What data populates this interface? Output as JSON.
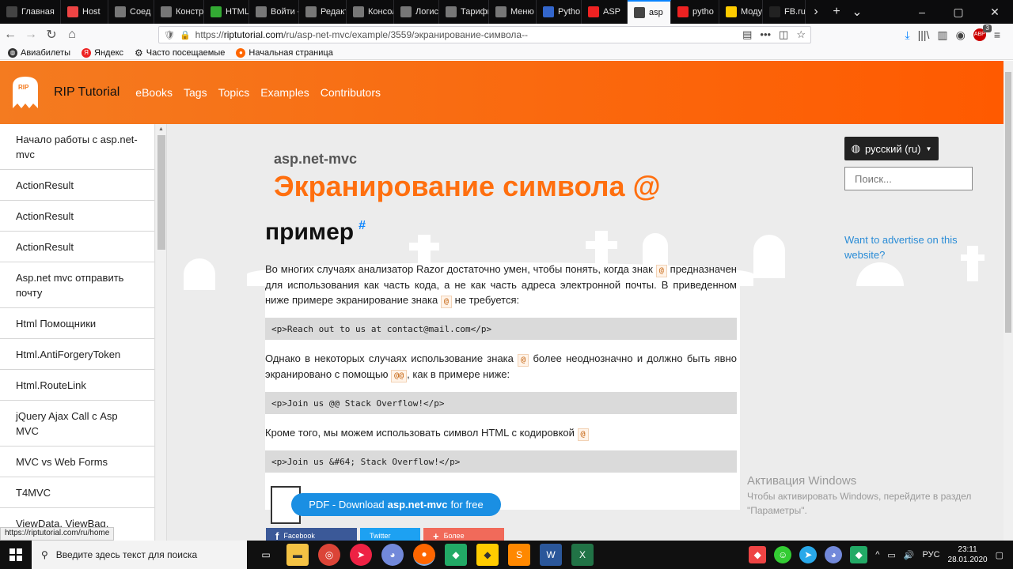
{
  "browser": {
    "tabs": [
      {
        "label": "Главная",
        "icon": "page-icon",
        "color": "#444"
      },
      {
        "label": "Host",
        "icon": "microsoft-icon",
        "color": "#e44"
      },
      {
        "label": "Соед",
        "icon": "warning-icon",
        "color": "#777"
      },
      {
        "label": "Конструк",
        "icon": "page-icon",
        "color": "#777"
      },
      {
        "label": "HTML",
        "icon": "html-icon",
        "color": "#3a3"
      },
      {
        "label": "Войти ‹ Л",
        "icon": "page-icon",
        "color": "#777"
      },
      {
        "label": "Редактиро",
        "icon": "page-icon",
        "color": "#777"
      },
      {
        "label": "Консоль",
        "icon": "page-icon",
        "color": "#777"
      },
      {
        "label": "Логистик",
        "icon": "page-icon",
        "color": "#777"
      },
      {
        "label": "Тарифы –",
        "icon": "page-icon",
        "color": "#777"
      },
      {
        "label": "Меню ‹ Л",
        "icon": "page-icon",
        "color": "#777"
      },
      {
        "label": "Pytho",
        "icon": "python-icon",
        "color": "#36c"
      },
      {
        "label": "ASP",
        "icon": "yandex-icon",
        "color": "#e22"
      },
      {
        "label": "asp",
        "icon": "riptutorial-icon",
        "color": "#444"
      },
      {
        "label": "pytho",
        "icon": "yandex-icon",
        "color": "#e22"
      },
      {
        "label": "Моду",
        "icon": "python-icon",
        "color": "#fc0"
      },
      {
        "label": "FB.ru",
        "icon": "fb-icon",
        "color": "#222"
      }
    ],
    "url_prefix": "https://",
    "url_domain": "riptutorial.com",
    "url_path": "/ru/asp-net-mvc/example/3559/экранирование-символа--",
    "notification_count": "3",
    "bookmarks": [
      "Авиабилеты",
      "Яндекс",
      "Часто посещаемые",
      "Начальная страница"
    ]
  },
  "site": {
    "brand": "RIP Tutorial",
    "nav": [
      "eBooks",
      "Tags",
      "Topics",
      "Examples",
      "Contributors"
    ],
    "sidebar": [
      "Начало работы с asp.net-mvc",
      "ActionResult",
      "ActionResult",
      "ActionResult",
      "Asp.net mvc отправить почту",
      "Html Помощники",
      "Html.AntiForgeryToken",
      "Html.RouteLink",
      "jQuery Ajax Call с Asp MVC",
      "MVC vs Web Forms",
      "T4MVC",
      "ViewData, ViewBag, TempData"
    ],
    "breadcrumb": "asp.net-mvc",
    "title": "Экранирование символа @",
    "section_heading": "пример",
    "section_hash": "#",
    "p1_a": "Во многих случаях анализатор Razor достаточно умен, чтобы понять, когда знак",
    "p1_b": "предназначен для использования как часть кода, а не как часть адреса электронной почты. В приведенном ниже примере экранирование знака",
    "p1_c": "не требуется:",
    "at": "@",
    "at_double": "@@",
    "code1": "<p>Reach out to us at contact@mail.com</p>",
    "p2_a": "Однако в некоторых случаях использование знака",
    "p2_b": "более неоднозначно и должно быть явно экранировано с помощью",
    "p2_c": ", как в примере ниже:",
    "code2": "<p>Join us @@ Stack Overflow!</p>",
    "p3_a": "Кроме того, мы можем использовать символ HTML с кодировкой",
    "code3": "<p>Join us &#64; Stack Overflow!</p>",
    "lang_button": "русский (ru)",
    "search_placeholder": "Поиск...",
    "advert": "Want to advertise on this website?",
    "pdf_prefix": "PDF - Download",
    "pdf_bold": "asp.net-mvc",
    "pdf_suffix": "for free",
    "share_facebook": "Facebook",
    "share_twitter": "Twitter",
    "share_more": "Более"
  },
  "status_url": "https://riptutorial.com/ru/home",
  "windows": {
    "activation_title": "Активация Windows",
    "activation_text": "Чтобы активировать Windows, перейдите в раздел \"Параметры\".",
    "search_placeholder": "Введите здесь текст для поиска",
    "lang": "РУС",
    "time": "23:11",
    "date": "28.01.2020"
  },
  "colors": {
    "header_orange": "#f47b20",
    "title_orange": "#ff6f0f",
    "link_blue": "#2a8cd6",
    "pdf_blue": "#1a8fe3"
  }
}
